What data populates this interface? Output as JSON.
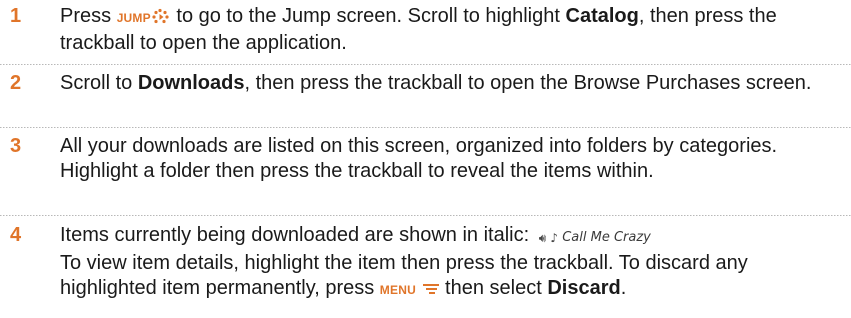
{
  "steps": [
    {
      "number": "1",
      "segments": {
        "a": "Press ",
        "key": "JUMP",
        "b": " to go to the Jump screen. Scroll to highlight ",
        "bold": "Catalog",
        "c": ", then press the trackball to open the application."
      }
    },
    {
      "number": "2",
      "segments": {
        "a": "Scroll to ",
        "bold": "Downloads",
        "b": ", then press the trackball to open the Browse Purchases screen."
      }
    },
    {
      "number": "3",
      "segments": {
        "a": "All your downloads are listed on this screen, organized into folders by categories. Highlight a folder then press the trackball to reveal the items within."
      }
    },
    {
      "number": "4",
      "segments": {
        "a": "Items currently being downloaded are shown in italic: ",
        "sample_text": "Call Me Crazy",
        "b": "To view item details, highlight the item then press the trackball. To discard any highlighted item permanently, press ",
        "key": "MENU",
        "c": " then select ",
        "bold": "Discard",
        "d": "."
      }
    }
  ],
  "icons": {
    "jump_key": "jump-key-icon",
    "menu_key": "menu-key-icon",
    "speaker": "speaker-icon",
    "music_note": "music-note-icon"
  },
  "colors": {
    "step_number": "#e0752a",
    "key_label": "#e0752a",
    "body_text": "#1a1a1a",
    "divider": "#b8b8b8"
  }
}
